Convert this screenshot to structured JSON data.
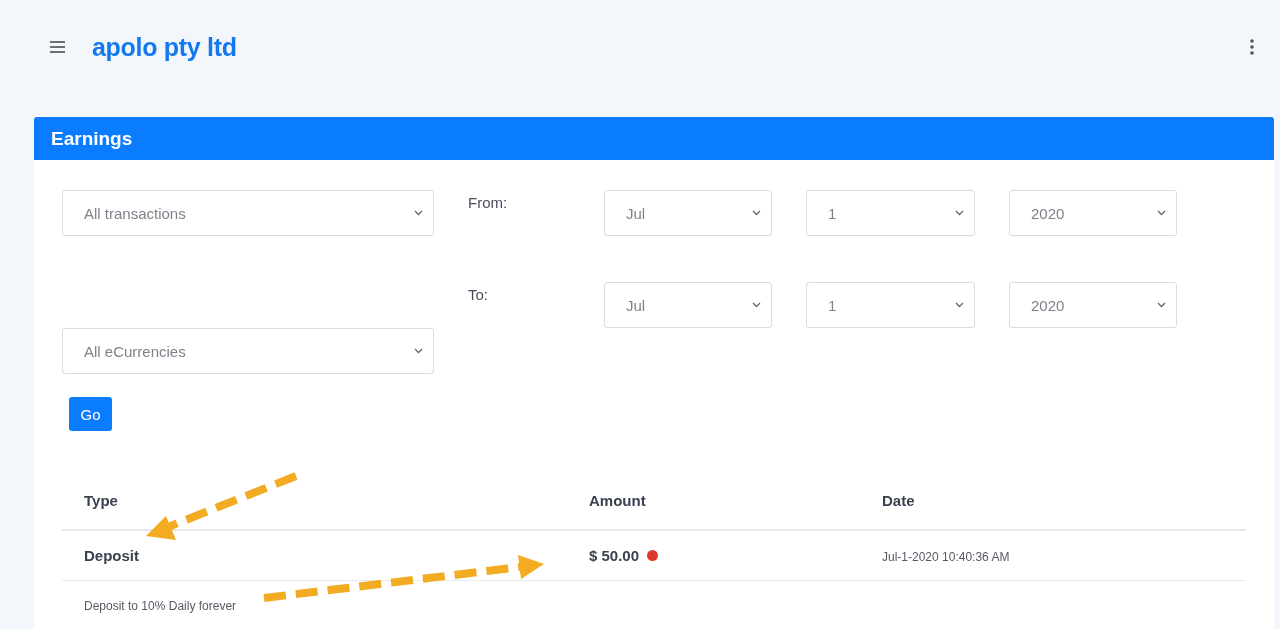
{
  "header": {
    "brand": "apolo pty ltd"
  },
  "card": {
    "title": "Earnings"
  },
  "filters": {
    "type_select": "All transactions",
    "from_label": "From:",
    "from": [
      "Jul",
      "1",
      "2020"
    ],
    "to_label": "To:",
    "to": [
      "Jul",
      "1",
      "2020"
    ],
    "currency_select": "All eCurrencies",
    "go_button": "Go"
  },
  "table": {
    "columns": [
      "Type",
      "Amount",
      "Date"
    ],
    "rows": [
      {
        "type": "Deposit",
        "amount": "$ 50.00",
        "date": "Jul-1-2020 10:40:36 AM",
        "description": "Deposit to 10% Daily forever"
      }
    ]
  }
}
